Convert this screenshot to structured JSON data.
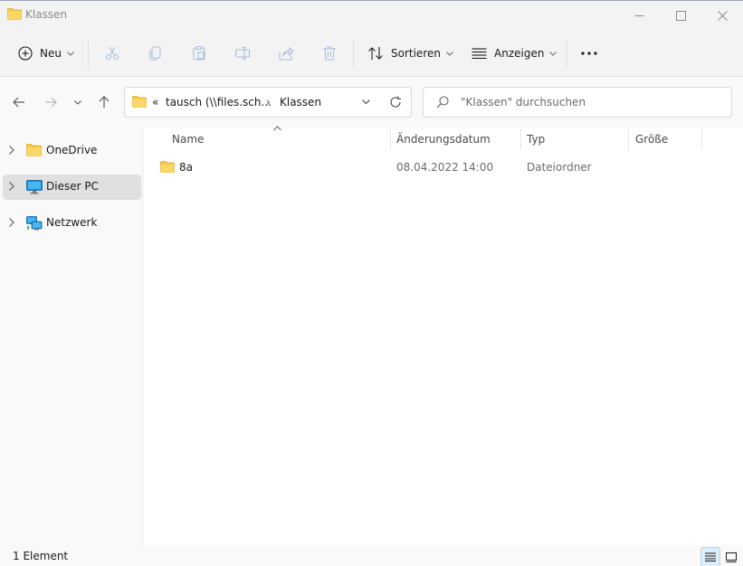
{
  "window": {
    "title": "Klassen",
    "controls": [
      "minimize-icon",
      "maximize-icon",
      "close-icon"
    ]
  },
  "toolbar": {
    "new_label": "Neu",
    "icons": [
      "cut-icon",
      "copy-icon",
      "paste-icon",
      "rename-icon",
      "share-icon",
      "delete-icon"
    ],
    "sort_label": "Sortieren",
    "view_label": "Anzeigen",
    "more_icon": "ellipsis-icon"
  },
  "address": {
    "overflow": "«",
    "crumb1": "tausch (\\\\files.sch...",
    "separator": "›",
    "crumb2": "Klassen"
  },
  "search": {
    "placeholder": "\"Klassen\" durchsuchen"
  },
  "sidebar": {
    "items": [
      {
        "label": "OneDrive",
        "icon": "folder-icon",
        "selected": false
      },
      {
        "label": "Dieser PC",
        "icon": "monitor-icon",
        "selected": true
      },
      {
        "label": "Netzwerk",
        "icon": "network-icon",
        "selected": false
      }
    ]
  },
  "columns": {
    "name": "Name",
    "modified": "Änderungsdatum",
    "type": "Typ",
    "size": "Größe"
  },
  "files": [
    {
      "name": "8a",
      "modified": "08.04.2022 14:00",
      "type": "Dateiordner",
      "size": ""
    }
  ],
  "status": {
    "count": "1 Element"
  },
  "colors": {
    "folder_yellow": "#f8c845",
    "selection_gray": "#e0e0e0",
    "accent_blue": "#0067c0"
  }
}
